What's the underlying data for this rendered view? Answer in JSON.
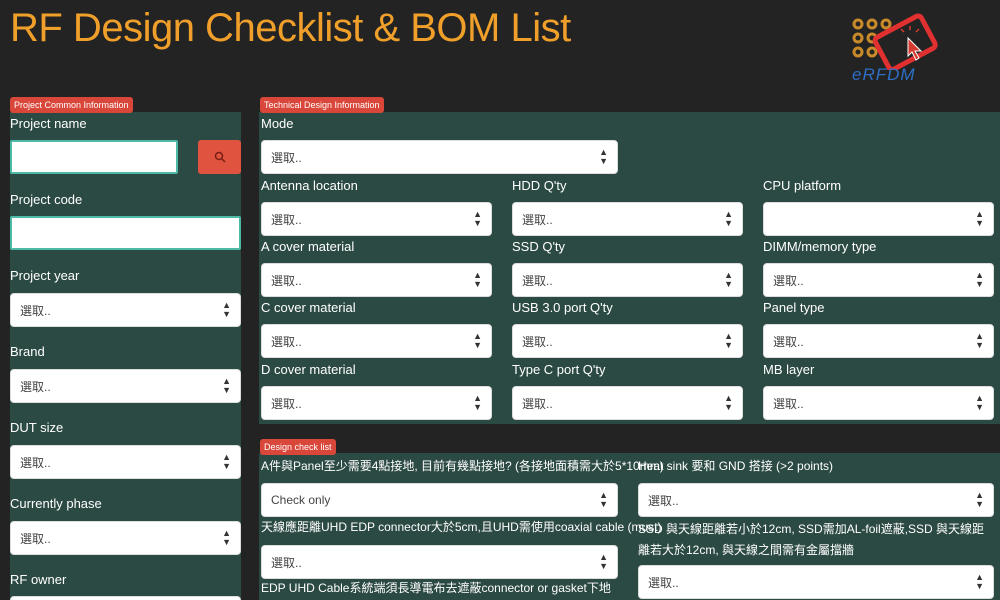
{
  "header": {
    "title": "RF Design Checklist & BOM List",
    "logo_text": "eRFDM"
  },
  "project_info": {
    "badge": "Project Common Information",
    "project_name_label": "Project name",
    "project_name_value": "",
    "project_code_label": "Project code",
    "project_code_value": "",
    "project_year_label": "Project year",
    "project_year_value": "選取..",
    "brand_label": "Brand",
    "brand_value": "選取..",
    "dut_size_label": "DUT size",
    "dut_size_value": "選取..",
    "phase_label": "Currently phase",
    "phase_value": "選取..",
    "rf_owner_label": "RF owner"
  },
  "technical": {
    "badge": "Technical Design Information",
    "mode_label": "Mode",
    "mode_value": "選取..",
    "fields": [
      {
        "label": "Antenna location",
        "value": "選取.."
      },
      {
        "label": "HDD Q'ty",
        "value": "選取.."
      },
      {
        "label": "CPU platform",
        "value": ""
      },
      {
        "label": "A cover material",
        "value": "選取.."
      },
      {
        "label": "SSD Q'ty",
        "value": "選取.."
      },
      {
        "label": "DIMM/memory type",
        "value": "選取.."
      },
      {
        "label": "C cover material",
        "value": "選取.."
      },
      {
        "label": "USB 3.0 port Q'ty",
        "value": "選取.."
      },
      {
        "label": "Panel type",
        "value": "選取.."
      },
      {
        "label": "D cover material",
        "value": "選取.."
      },
      {
        "label": "Type C port Q'ty",
        "value": "選取.."
      },
      {
        "label": "MB layer",
        "value": "選取.."
      }
    ]
  },
  "checklist": {
    "badge": "Design check list",
    "items": [
      {
        "label": "A件與Panel至少需要4點接地, 目前有幾點接地? (各接地面積需大於5*10mm)",
        "value": "Check only"
      },
      {
        "label": "Heat sink 要和 GND 搭接 (>2 points)",
        "value": "選取.."
      },
      {
        "label": "天線應距離UHD EDP connector大於5cm,且UHD需使用coaxial cable (must)",
        "value": "選取.."
      },
      {
        "label": "SSD 與天線距離若小於12cm, SSD需加AL-foil遮蔽,SSD 與天線距離若大於12cm, 與天線之間需有金屬擋牆",
        "value": "選取.."
      },
      {
        "label": "EDP UHD Cable系統端須長導電布去遮蔽connector or gasket下地",
        "value": ""
      }
    ]
  },
  "colors": {
    "accent": "#f0a02a",
    "badge": "#d9473a",
    "panel": "#2c4a44",
    "background": "#232323"
  }
}
